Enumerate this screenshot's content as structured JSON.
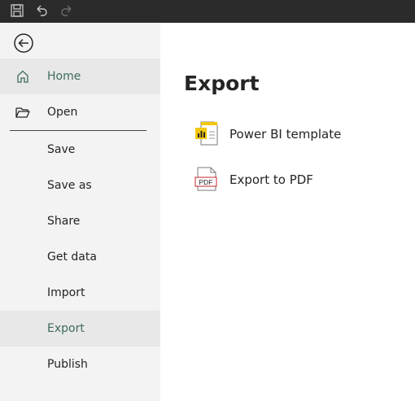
{
  "titlebar": {
    "icons": [
      "save-icon",
      "undo-icon",
      "redo-icon"
    ],
    "bg_color": "#2b2b2b"
  },
  "sidebar": {
    "back_icon": "back-arrow-icon",
    "items": [
      {
        "label": "Home",
        "icon": "home-icon",
        "selected": true
      },
      {
        "label": "Open",
        "icon": "folder-open-icon",
        "selected": false
      },
      {
        "label": "Save",
        "selected": false
      },
      {
        "label": "Save as",
        "selected": false
      },
      {
        "label": "Share",
        "selected": false
      },
      {
        "label": "Get data",
        "selected": false
      },
      {
        "label": "Import",
        "selected": false
      },
      {
        "label": "Export",
        "selected": true
      },
      {
        "label": "Publish",
        "selected": false
      }
    ],
    "accent_color": "#3d6b59"
  },
  "main": {
    "title": "Export",
    "options": [
      {
        "label": "Power BI template",
        "icon": "powerbi-template-icon"
      },
      {
        "label": "Export to PDF",
        "icon": "pdf-file-icon",
        "icon_text": "PDF"
      }
    ]
  }
}
